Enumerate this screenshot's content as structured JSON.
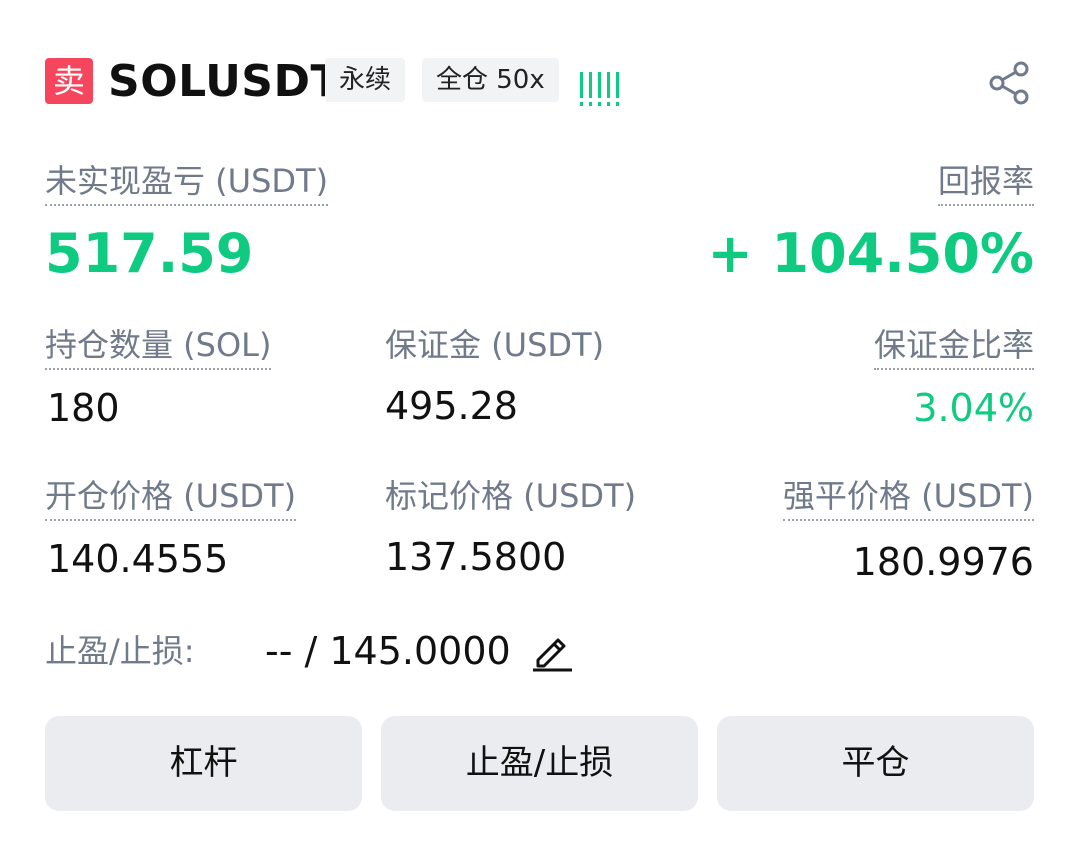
{
  "header": {
    "side_badge": "卖",
    "symbol": "SOLUSDT",
    "contract_type": "永续",
    "margin_mode": "全仓 50x",
    "risk_level_bars": 5,
    "share_icon": "share-icon"
  },
  "pnl": {
    "label": "未实现盈亏 (USDT)",
    "value": "517.59",
    "roe_label": "回报率",
    "roe_value": "+ 104.50%"
  },
  "row1": {
    "size_label": "持仓数量 (SOL)",
    "size_value": "180",
    "margin_label": "保证金 (USDT)",
    "margin_value": "495.28",
    "margin_ratio_label": "保证金比率",
    "margin_ratio_value": "3.04%"
  },
  "row2": {
    "entry_label": "开仓价格 (USDT)",
    "entry_value": "140.4555",
    "mark_label": "标记价格 (USDT)",
    "mark_value": "137.5800",
    "liq_label": "强平价格 (USDT)",
    "liq_value": "180.9976"
  },
  "tpsl": {
    "label": "止盈/止损:",
    "value": "-- / 145.0000",
    "edit_icon": "pencil-icon"
  },
  "buttons": {
    "leverage": "杠杆",
    "tpsl": "止盈/止损",
    "close": "平仓"
  },
  "colors": {
    "sell": "#f6465d",
    "profit": "#0ecb81",
    "label": "#707a8a",
    "button_bg": "#eaecef"
  }
}
